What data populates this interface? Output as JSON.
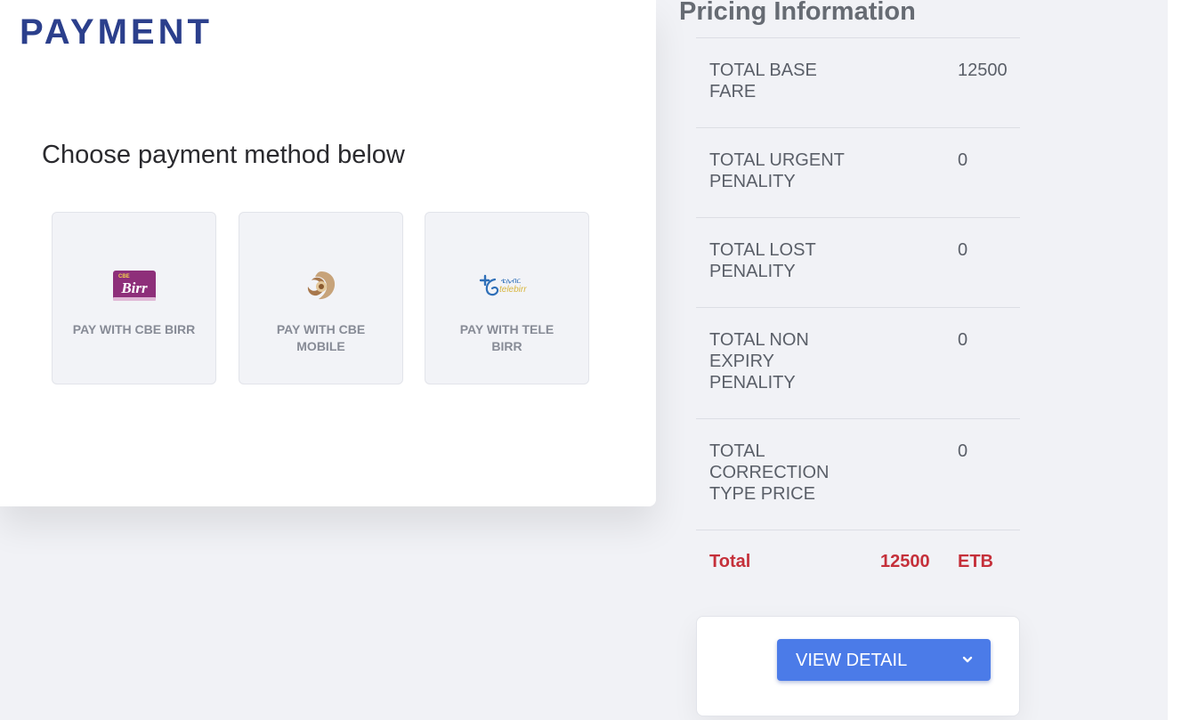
{
  "payment": {
    "title": "PAYMENT",
    "subtitle": "Choose payment method below",
    "methods": [
      {
        "label": "PAY WITH CBE BIRR",
        "icon": "cbe-birr-logo",
        "logo_text": "Birr",
        "logo_small": "CBE"
      },
      {
        "label": "PAY WITH CBE MOBILE",
        "icon": "cbe-mobile-logo"
      },
      {
        "label": "PAY WITH TELE BIRR",
        "icon": "telebirr-logo",
        "logo_top": "ቴሌብር",
        "logo_bottom": "telebirr"
      }
    ]
  },
  "pricing": {
    "title": "Pricing Information",
    "rows": [
      {
        "name": "TOTAL BASE FARE",
        "value": "12500"
      },
      {
        "name": "TOTAL URGENT PENALITY",
        "value": "0"
      },
      {
        "name": "TOTAL LOST PENALITY",
        "value": "0"
      },
      {
        "name": "TOTAL NON EXPIRY PENALITY",
        "value": "0"
      },
      {
        "name": "TOTAL CORRECTION TYPE PRICE",
        "value": "0"
      }
    ],
    "total": {
      "label": "Total",
      "amount": "12500",
      "currency": "ETB"
    },
    "view_detail_label": "VIEW DETAIL",
    "view_detail_icon": "chevron-down-icon"
  },
  "colors": {
    "brand_blue": "#2b3f8c",
    "button_blue": "#4b7be8",
    "total_red": "#c5303a",
    "background": "#f1f2f6"
  }
}
